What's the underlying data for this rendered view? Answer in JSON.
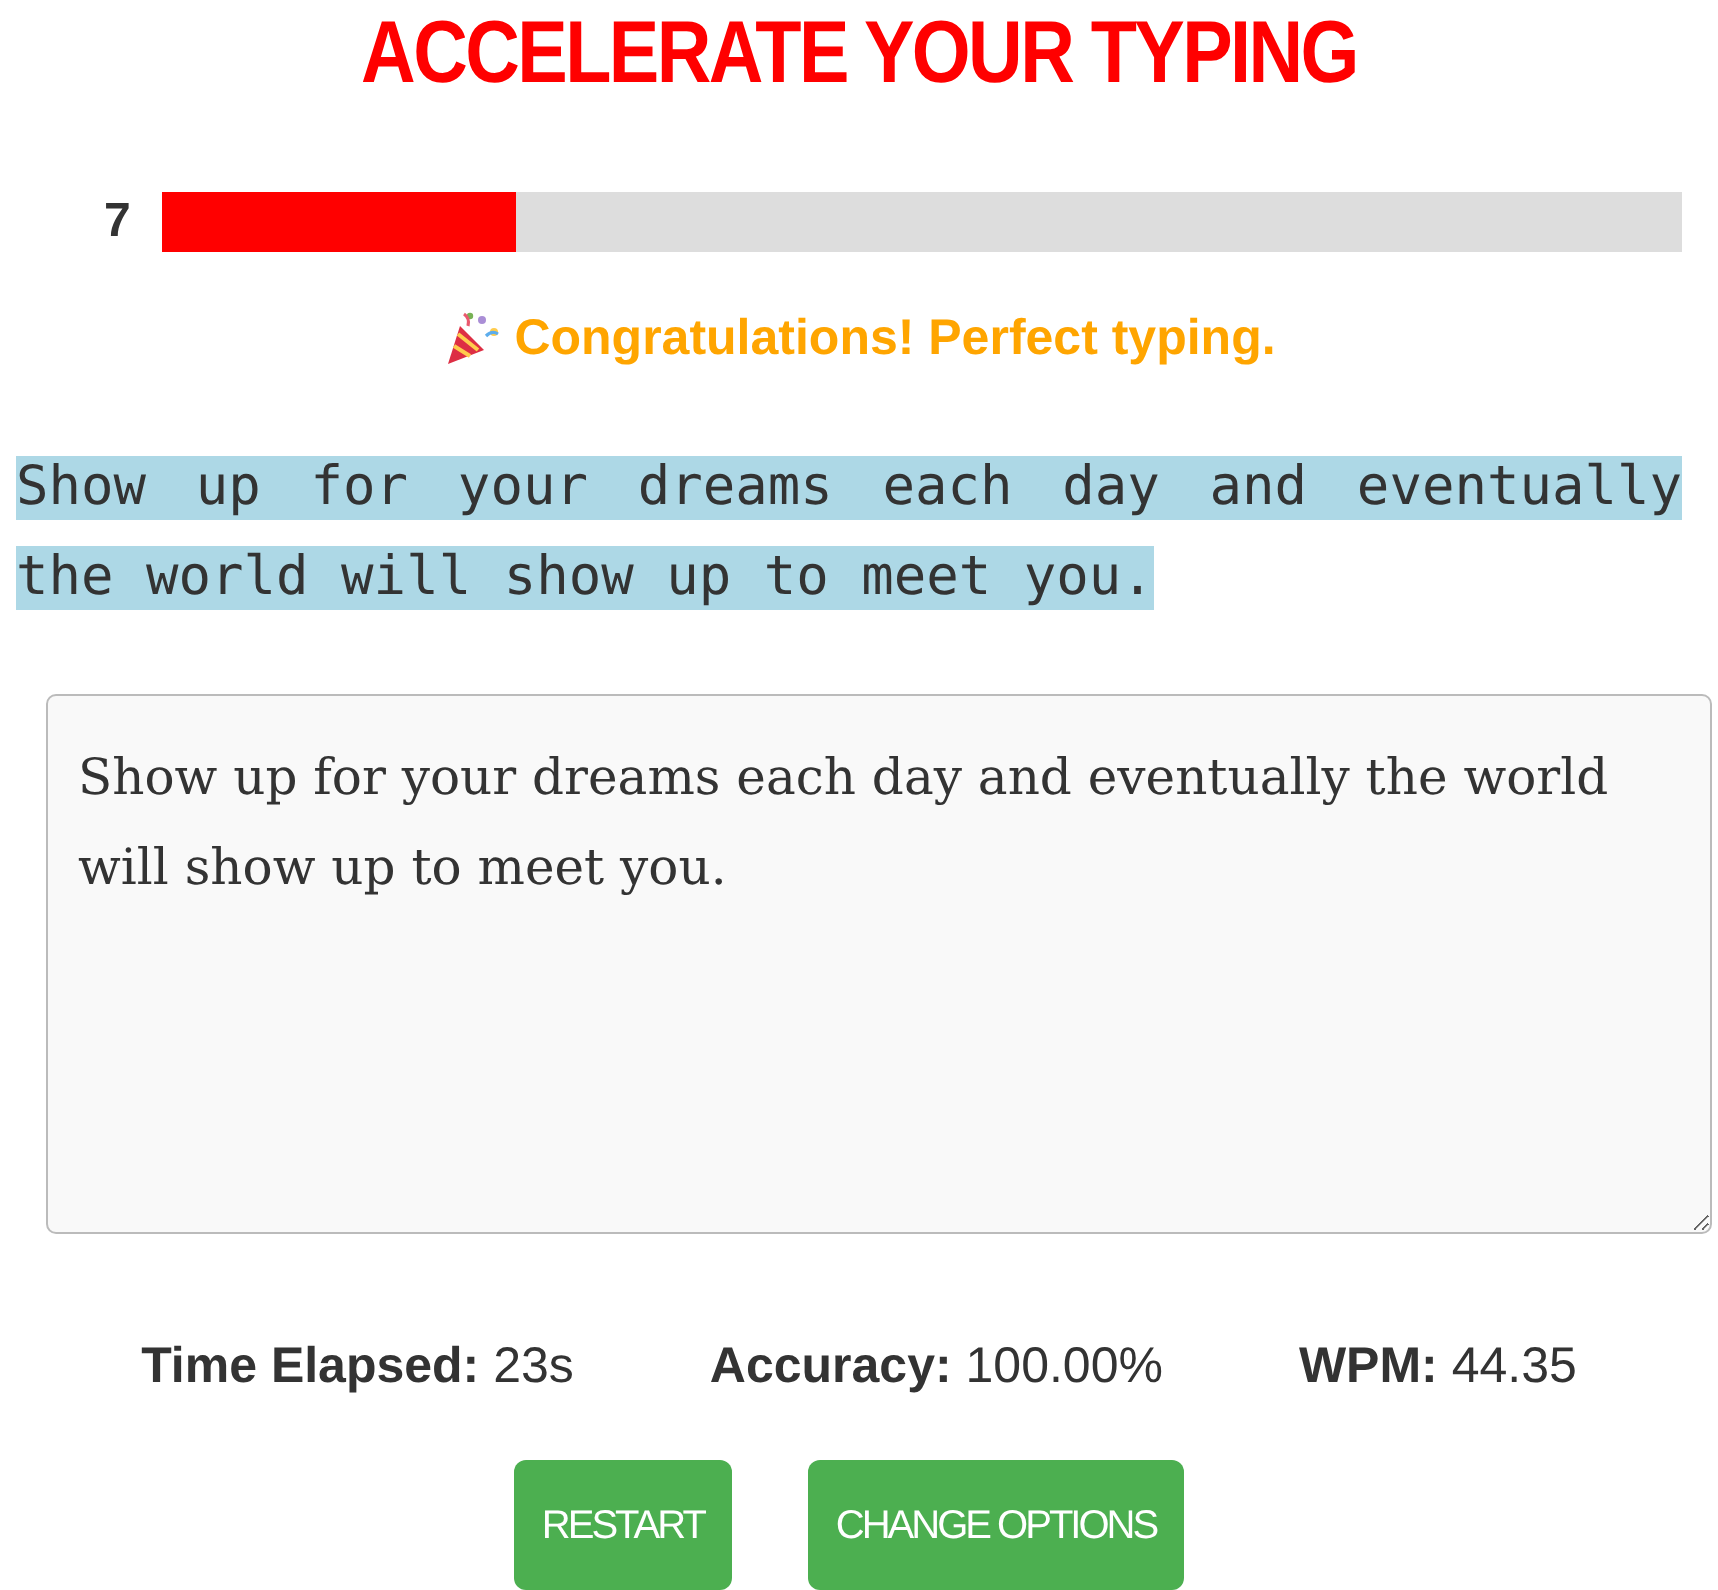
{
  "title": "ACCELERATE YOUR TYPING",
  "progress": {
    "count": "7",
    "level": 0.232
  },
  "message": "Congratulations! Perfect typing.",
  "prompt_lines": [
    "Show up for your dreams each day and eventually",
    "the world will show up to meet you."
  ],
  "input": {
    "value": "Show up for your dreams each day and eventually the world will show up to meet you."
  },
  "stats": [
    {
      "text": "**Time Elapsed:** 23s"
    },
    {
      "text": "**Accuracy:** 100.00%"
    },
    {
      "text": "**WPM:** 44.35"
    }
  ],
  "buttons": [
    "RESTART",
    "CHANGE OPTIONS"
  ]
}
